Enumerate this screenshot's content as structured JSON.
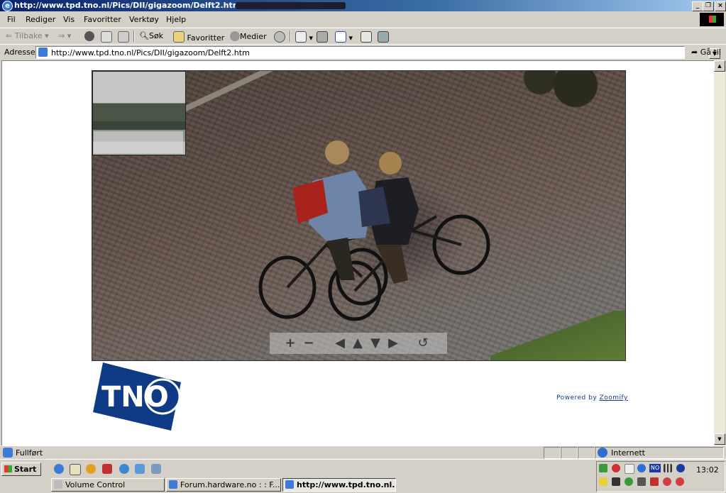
{
  "window": {
    "title": "http://www.tpd.tno.nl/Pics/DII/gigazoom/Delft2.htm - "
  },
  "menu": [
    "Fil",
    "Rediger",
    "Vis",
    "Favoritter",
    "Verktøy",
    "Hjelp"
  ],
  "toolbar": {
    "back": "Tilbake",
    "search": "Søk",
    "favorites": "Favoritter",
    "media": "Medier"
  },
  "address": {
    "label": "Adresse",
    "url": "http://www.tpd.tno.nl/Pics/DII/gigazoom/Delft2.htm",
    "go": "Gå til"
  },
  "page": {
    "logo_text": "TNO",
    "powered_prefix": "Powered by ",
    "powered_link": "Zoomify"
  },
  "status": {
    "text": "Fullført",
    "zone": "Internett"
  },
  "taskbar": {
    "start": "Start",
    "tasks": [
      "Volume Control",
      "Forum.hardware.no : : F...",
      "http://www.tpd.tno.nl..."
    ],
    "clock": "13:02",
    "tray_lang": "NO"
  },
  "colors": {
    "title_gradient_start": "#0a246a",
    "tno_blue": "#0f3b86",
    "link_blue": "#1a3a8c"
  }
}
